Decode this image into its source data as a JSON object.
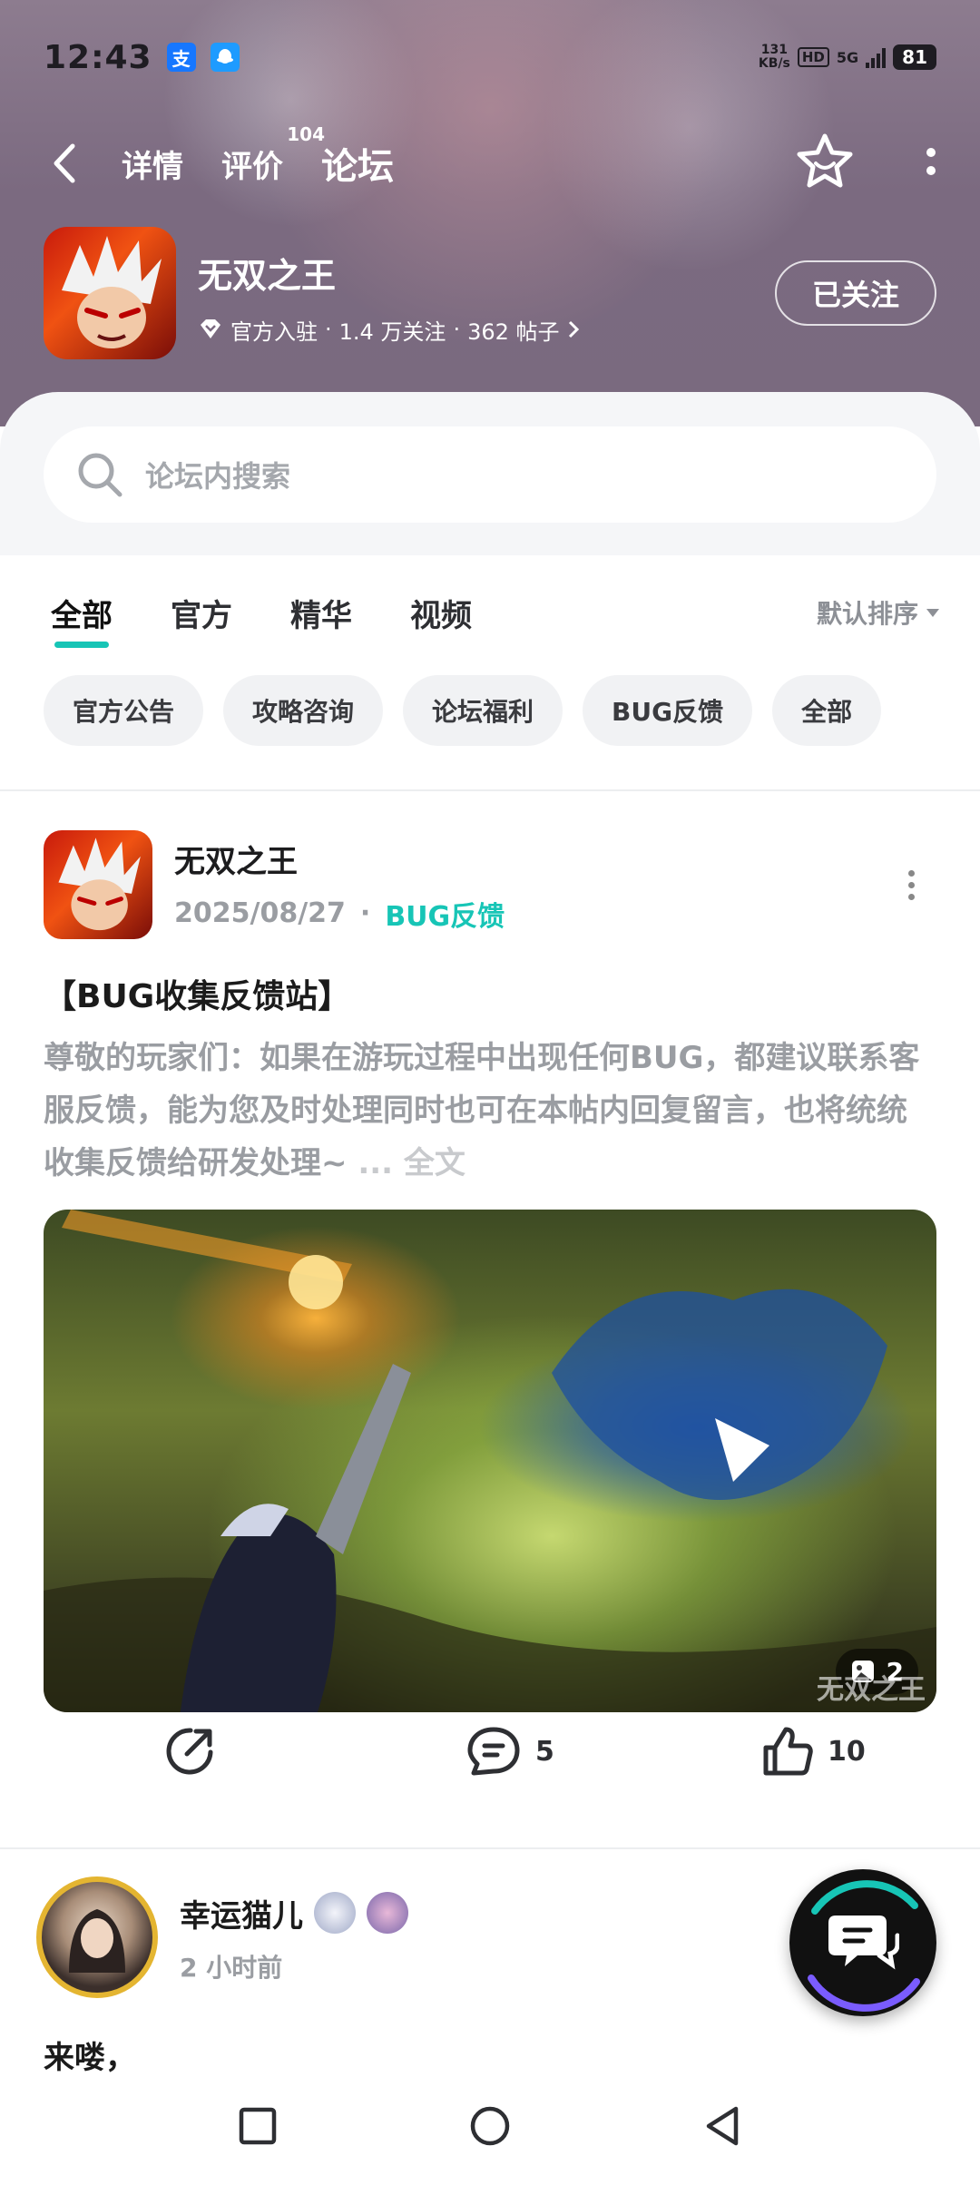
{
  "status_bar": {
    "time": "12:43",
    "speed_value": "131",
    "speed_unit": "KB/s",
    "hd": "HD",
    "network": "5G",
    "battery": "81",
    "app_icon_1": "支"
  },
  "nav": {
    "tabs": [
      {
        "label": "详情"
      },
      {
        "label": "评价",
        "badge": "104"
      },
      {
        "label": "论坛"
      }
    ]
  },
  "game": {
    "name": "无双之王",
    "official": "官方入驻",
    "followers": "1.4 万关注",
    "posts": "362 帖子",
    "follow_label": "已关注"
  },
  "search": {
    "placeholder": "论坛内搜索"
  },
  "tabs": [
    "全部",
    "官方",
    "精华",
    "视频"
  ],
  "sort_label": "默认排序",
  "chips": [
    "官方公告",
    "攻略咨询",
    "论坛福利",
    "BUG反馈",
    "全部"
  ],
  "post": {
    "author": "无双之王",
    "date": "2025/08/27",
    "separator": "·",
    "tag": "BUG反馈",
    "title": "【BUG收集反馈站】",
    "body": "尊敬的玩家们：如果在游玩过程中出现任何BUG，都建议联系客服反馈，能为您及时处理同时也可在本帖内回复留言，也将统统收集反馈给研发处理~",
    "ellipsis": " ...",
    "full_label": " 全文",
    "image_count": "2",
    "watermark": "无双之王",
    "comments": "5",
    "likes": "10"
  },
  "comment": {
    "author": "幸运猫儿",
    "time": "2 小时前",
    "text": "来喽，"
  },
  "colors": {
    "accent": "#17c5b6",
    "header": "#7b6a80"
  }
}
